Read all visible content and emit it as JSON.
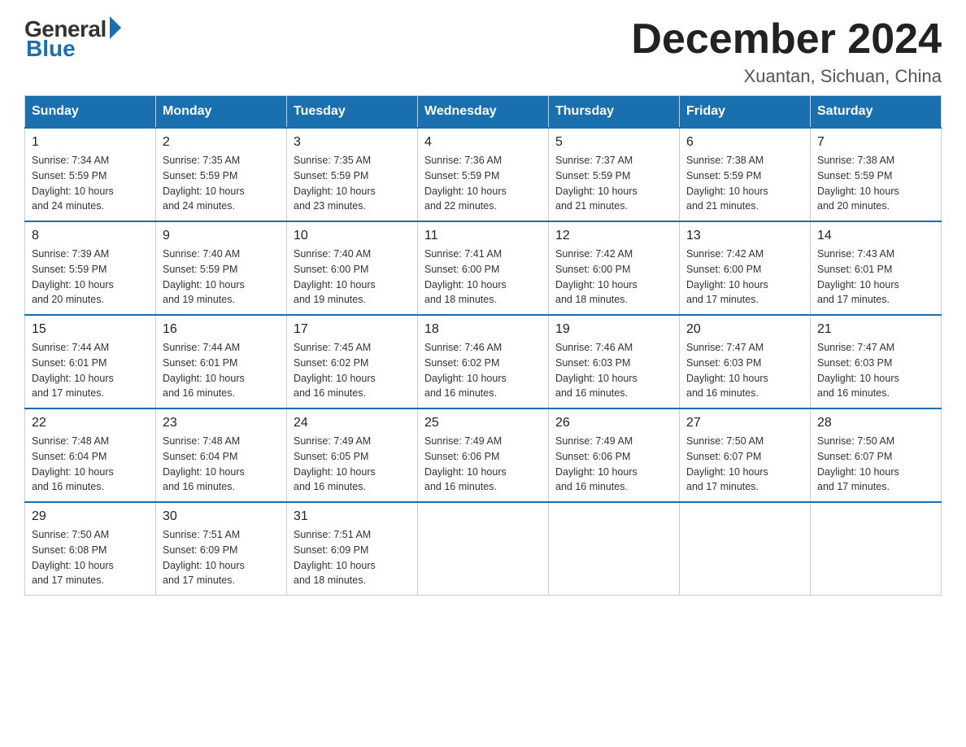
{
  "header": {
    "logo_general": "General",
    "logo_blue": "Blue",
    "month_title": "December 2024",
    "location": "Xuantan, Sichuan, China"
  },
  "days_of_week": [
    "Sunday",
    "Monday",
    "Tuesday",
    "Wednesday",
    "Thursday",
    "Friday",
    "Saturday"
  ],
  "weeks": [
    [
      {
        "day": "1",
        "sunrise": "7:34 AM",
        "sunset": "5:59 PM",
        "daylight": "10 hours and 24 minutes."
      },
      {
        "day": "2",
        "sunrise": "7:35 AM",
        "sunset": "5:59 PM",
        "daylight": "10 hours and 24 minutes."
      },
      {
        "day": "3",
        "sunrise": "7:35 AM",
        "sunset": "5:59 PM",
        "daylight": "10 hours and 23 minutes."
      },
      {
        "day": "4",
        "sunrise": "7:36 AM",
        "sunset": "5:59 PM",
        "daylight": "10 hours and 22 minutes."
      },
      {
        "day": "5",
        "sunrise": "7:37 AM",
        "sunset": "5:59 PM",
        "daylight": "10 hours and 21 minutes."
      },
      {
        "day": "6",
        "sunrise": "7:38 AM",
        "sunset": "5:59 PM",
        "daylight": "10 hours and 21 minutes."
      },
      {
        "day": "7",
        "sunrise": "7:38 AM",
        "sunset": "5:59 PM",
        "daylight": "10 hours and 20 minutes."
      }
    ],
    [
      {
        "day": "8",
        "sunrise": "7:39 AM",
        "sunset": "5:59 PM",
        "daylight": "10 hours and 20 minutes."
      },
      {
        "day": "9",
        "sunrise": "7:40 AM",
        "sunset": "5:59 PM",
        "daylight": "10 hours and 19 minutes."
      },
      {
        "day": "10",
        "sunrise": "7:40 AM",
        "sunset": "6:00 PM",
        "daylight": "10 hours and 19 minutes."
      },
      {
        "day": "11",
        "sunrise": "7:41 AM",
        "sunset": "6:00 PM",
        "daylight": "10 hours and 18 minutes."
      },
      {
        "day": "12",
        "sunrise": "7:42 AM",
        "sunset": "6:00 PM",
        "daylight": "10 hours and 18 minutes."
      },
      {
        "day": "13",
        "sunrise": "7:42 AM",
        "sunset": "6:00 PM",
        "daylight": "10 hours and 17 minutes."
      },
      {
        "day": "14",
        "sunrise": "7:43 AM",
        "sunset": "6:01 PM",
        "daylight": "10 hours and 17 minutes."
      }
    ],
    [
      {
        "day": "15",
        "sunrise": "7:44 AM",
        "sunset": "6:01 PM",
        "daylight": "10 hours and 17 minutes."
      },
      {
        "day": "16",
        "sunrise": "7:44 AM",
        "sunset": "6:01 PM",
        "daylight": "10 hours and 16 minutes."
      },
      {
        "day": "17",
        "sunrise": "7:45 AM",
        "sunset": "6:02 PM",
        "daylight": "10 hours and 16 minutes."
      },
      {
        "day": "18",
        "sunrise": "7:46 AM",
        "sunset": "6:02 PM",
        "daylight": "10 hours and 16 minutes."
      },
      {
        "day": "19",
        "sunrise": "7:46 AM",
        "sunset": "6:03 PM",
        "daylight": "10 hours and 16 minutes."
      },
      {
        "day": "20",
        "sunrise": "7:47 AM",
        "sunset": "6:03 PM",
        "daylight": "10 hours and 16 minutes."
      },
      {
        "day": "21",
        "sunrise": "7:47 AM",
        "sunset": "6:03 PM",
        "daylight": "10 hours and 16 minutes."
      }
    ],
    [
      {
        "day": "22",
        "sunrise": "7:48 AM",
        "sunset": "6:04 PM",
        "daylight": "10 hours and 16 minutes."
      },
      {
        "day": "23",
        "sunrise": "7:48 AM",
        "sunset": "6:04 PM",
        "daylight": "10 hours and 16 minutes."
      },
      {
        "day": "24",
        "sunrise": "7:49 AM",
        "sunset": "6:05 PM",
        "daylight": "10 hours and 16 minutes."
      },
      {
        "day": "25",
        "sunrise": "7:49 AM",
        "sunset": "6:06 PM",
        "daylight": "10 hours and 16 minutes."
      },
      {
        "day": "26",
        "sunrise": "7:49 AM",
        "sunset": "6:06 PM",
        "daylight": "10 hours and 16 minutes."
      },
      {
        "day": "27",
        "sunrise": "7:50 AM",
        "sunset": "6:07 PM",
        "daylight": "10 hours and 17 minutes."
      },
      {
        "day": "28",
        "sunrise": "7:50 AM",
        "sunset": "6:07 PM",
        "daylight": "10 hours and 17 minutes."
      }
    ],
    [
      {
        "day": "29",
        "sunrise": "7:50 AM",
        "sunset": "6:08 PM",
        "daylight": "10 hours and 17 minutes."
      },
      {
        "day": "30",
        "sunrise": "7:51 AM",
        "sunset": "6:09 PM",
        "daylight": "10 hours and 17 minutes."
      },
      {
        "day": "31",
        "sunrise": "7:51 AM",
        "sunset": "6:09 PM",
        "daylight": "10 hours and 18 minutes."
      },
      null,
      null,
      null,
      null
    ]
  ],
  "labels": {
    "sunrise": "Sunrise:",
    "sunset": "Sunset:",
    "daylight": "Daylight:"
  }
}
